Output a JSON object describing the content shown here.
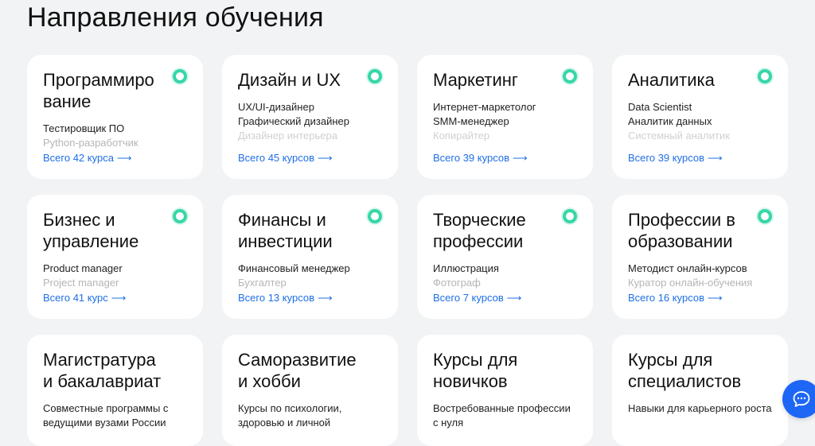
{
  "page_title": "Направления обучения",
  "cards": [
    {
      "title": "Программиро вание",
      "subs": [
        "Тестировщик ПО",
        "Python-разработчик"
      ],
      "link": "Всего 42 курса"
    },
    {
      "title": "Дизайн и UX",
      "subs": [
        "UX/UI-дизайнер",
        "Графический дизайнер",
        "Дизайнер интерьера"
      ],
      "link": "Всего 45 курсов"
    },
    {
      "title": "Маркетинг",
      "subs": [
        "Интернет-маркетолог",
        "SMM-менеджер",
        "Копирайтер"
      ],
      "link": "Всего 39 курсов"
    },
    {
      "title": "Аналитика",
      "subs": [
        "Data Scientist",
        "Аналитик данных",
        "Системный аналитик"
      ],
      "link": "Всего 39 курсов"
    },
    {
      "title": "Бизнес и управление",
      "subs": [
        "Product manager",
        "Project manager"
      ],
      "link": "Всего 41 курс"
    },
    {
      "title": "Финансы и инвестиции",
      "subs": [
        "Финансовый менеджер",
        "Бухгалтер"
      ],
      "link": "Всего 13 курсов"
    },
    {
      "title": "Творческие профессии",
      "subs": [
        "Иллюстрация",
        "Фотограф"
      ],
      "link": "Всего 7 курсов"
    },
    {
      "title": "Профессии в образовании",
      "subs": [
        "Методист онлайн-курсов",
        "Куратор онлайн-обучения"
      ],
      "link": "Всего 16 курсов"
    },
    {
      "title": "Магистратура и бакалавриат",
      "desc": "Совместные программы с ведущими вузами России"
    },
    {
      "title": "Саморазвитие и хобби",
      "desc": "Курсы по психологии, здоровью и личной"
    },
    {
      "title": "Курсы для новичков",
      "desc": "Востребованные профессии с нуля"
    },
    {
      "title": "Курсы для специалистов",
      "desc": "Навыки для карьерного роста"
    }
  ],
  "link_arrow": "⟶",
  "colors": {
    "accent_link": "#1f6fe5",
    "dot": "#37d6a8",
    "chat": "#1e66f5"
  },
  "icons": {
    "status_dot": "status-dot-icon",
    "chat": "chat-icon",
    "arrow": "arrow-right-icon"
  }
}
